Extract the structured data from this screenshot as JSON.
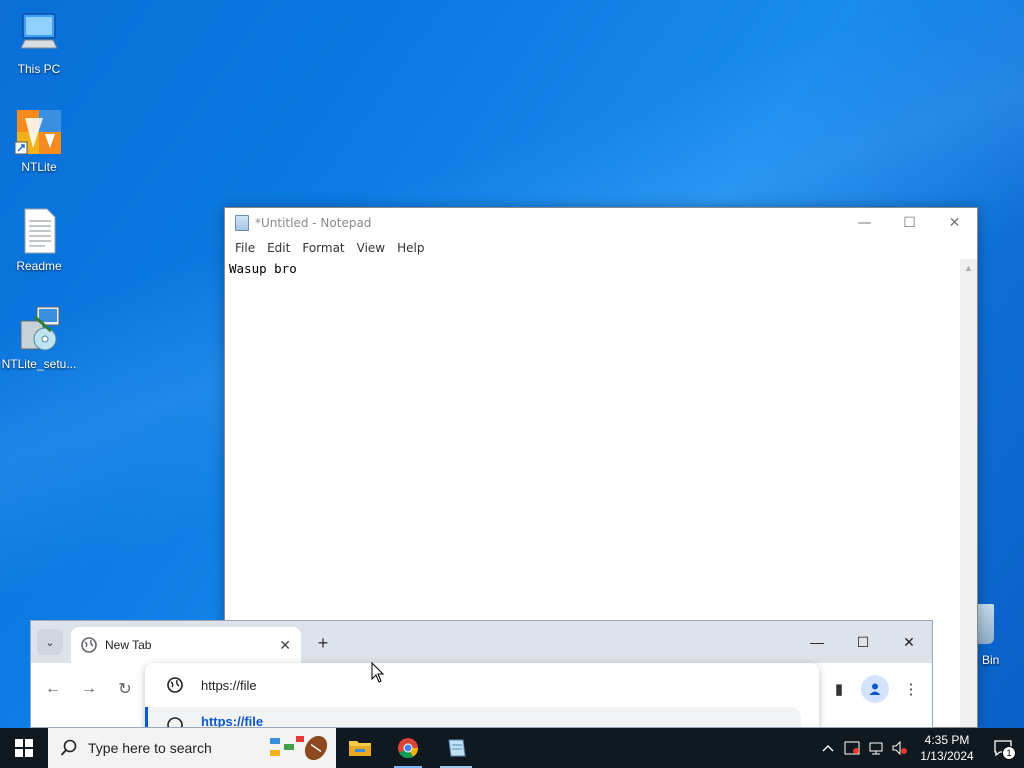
{
  "desktop": {
    "icons": [
      {
        "label": "This PC",
        "icon": "computer-icon"
      },
      {
        "label": "NTLite",
        "icon": "ntlite-app-icon"
      },
      {
        "label": "Readme",
        "icon": "text-document-icon"
      },
      {
        "label": "NTLite_setu...",
        "icon": "installer-icon"
      }
    ],
    "recycle_bin_label": "e Bin"
  },
  "notepad": {
    "title": "*Untitled - Notepad",
    "menu": [
      "File",
      "Edit",
      "Format",
      "View",
      "Help"
    ],
    "content": "Wasup bro",
    "controls": {
      "minimize": "—",
      "maximize": "☐",
      "close": "✕"
    }
  },
  "chrome": {
    "tab_title": "New Tab",
    "tab_close": "✕",
    "new_tab": "+",
    "omnibox_text": "https://file",
    "suggestion_text": "https://file",
    "controls": {
      "minimize": "—",
      "maximize": "☐",
      "close": "✕"
    }
  },
  "taskbar": {
    "search_placeholder": "Type here to search",
    "apps": [
      "file-explorer-icon",
      "chrome-icon",
      "notepad-icon"
    ],
    "clock_time": "4:35 PM",
    "clock_date": "1/13/2024",
    "notification_count": "1"
  },
  "colors": {
    "desktop_blue": "#0b7ae3",
    "taskbar": "#101820",
    "chrome_frame": "#dee3eb",
    "accent": "#0b57d0"
  }
}
